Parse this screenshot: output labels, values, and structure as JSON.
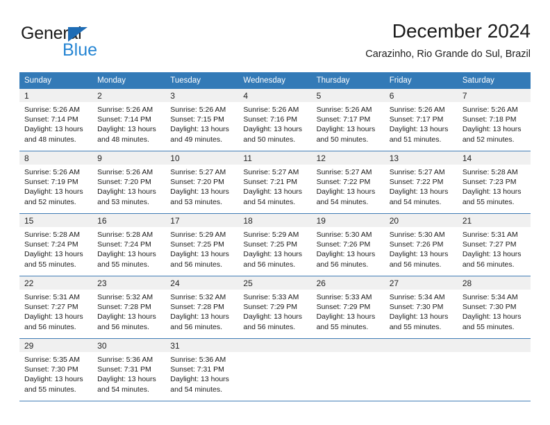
{
  "logo": {
    "primary_text": "General",
    "secondary_text": "Blue",
    "triangle_icon": "triangle-icon",
    "primary_color": "#1a1a1a",
    "secondary_color": "#2585d3",
    "triangle_color": "#1e6cb5"
  },
  "header": {
    "title": "December 2024",
    "subtitle": "Carazinho, Rio Grande do Sul, Brazil"
  },
  "theme": {
    "header_row_bg": "#337ab7",
    "header_row_text": "#ffffff",
    "day_number_bg": "#f0f0f0",
    "grid_line": "#3f7cb5",
    "body_text": "#1a1a1a"
  },
  "weekdays": [
    "Sunday",
    "Monday",
    "Tuesday",
    "Wednesday",
    "Thursday",
    "Friday",
    "Saturday"
  ],
  "calendar": {
    "month": "December",
    "year": 2024,
    "weeks": [
      [
        {
          "day": "1",
          "sunrise": "Sunrise: 5:26 AM",
          "sunset": "Sunset: 7:14 PM",
          "daylight_1": "Daylight: 13 hours",
          "daylight_2": "and 48 minutes."
        },
        {
          "day": "2",
          "sunrise": "Sunrise: 5:26 AM",
          "sunset": "Sunset: 7:14 PM",
          "daylight_1": "Daylight: 13 hours",
          "daylight_2": "and 48 minutes."
        },
        {
          "day": "3",
          "sunrise": "Sunrise: 5:26 AM",
          "sunset": "Sunset: 7:15 PM",
          "daylight_1": "Daylight: 13 hours",
          "daylight_2": "and 49 minutes."
        },
        {
          "day": "4",
          "sunrise": "Sunrise: 5:26 AM",
          "sunset": "Sunset: 7:16 PM",
          "daylight_1": "Daylight: 13 hours",
          "daylight_2": "and 50 minutes."
        },
        {
          "day": "5",
          "sunrise": "Sunrise: 5:26 AM",
          "sunset": "Sunset: 7:17 PM",
          "daylight_1": "Daylight: 13 hours",
          "daylight_2": "and 50 minutes."
        },
        {
          "day": "6",
          "sunrise": "Sunrise: 5:26 AM",
          "sunset": "Sunset: 7:17 PM",
          "daylight_1": "Daylight: 13 hours",
          "daylight_2": "and 51 minutes."
        },
        {
          "day": "7",
          "sunrise": "Sunrise: 5:26 AM",
          "sunset": "Sunset: 7:18 PM",
          "daylight_1": "Daylight: 13 hours",
          "daylight_2": "and 52 minutes."
        }
      ],
      [
        {
          "day": "8",
          "sunrise": "Sunrise: 5:26 AM",
          "sunset": "Sunset: 7:19 PM",
          "daylight_1": "Daylight: 13 hours",
          "daylight_2": "and 52 minutes."
        },
        {
          "day": "9",
          "sunrise": "Sunrise: 5:26 AM",
          "sunset": "Sunset: 7:20 PM",
          "daylight_1": "Daylight: 13 hours",
          "daylight_2": "and 53 minutes."
        },
        {
          "day": "10",
          "sunrise": "Sunrise: 5:27 AM",
          "sunset": "Sunset: 7:20 PM",
          "daylight_1": "Daylight: 13 hours",
          "daylight_2": "and 53 minutes."
        },
        {
          "day": "11",
          "sunrise": "Sunrise: 5:27 AM",
          "sunset": "Sunset: 7:21 PM",
          "daylight_1": "Daylight: 13 hours",
          "daylight_2": "and 54 minutes."
        },
        {
          "day": "12",
          "sunrise": "Sunrise: 5:27 AM",
          "sunset": "Sunset: 7:22 PM",
          "daylight_1": "Daylight: 13 hours",
          "daylight_2": "and 54 minutes."
        },
        {
          "day": "13",
          "sunrise": "Sunrise: 5:27 AM",
          "sunset": "Sunset: 7:22 PM",
          "daylight_1": "Daylight: 13 hours",
          "daylight_2": "and 54 minutes."
        },
        {
          "day": "14",
          "sunrise": "Sunrise: 5:28 AM",
          "sunset": "Sunset: 7:23 PM",
          "daylight_1": "Daylight: 13 hours",
          "daylight_2": "and 55 minutes."
        }
      ],
      [
        {
          "day": "15",
          "sunrise": "Sunrise: 5:28 AM",
          "sunset": "Sunset: 7:24 PM",
          "daylight_1": "Daylight: 13 hours",
          "daylight_2": "and 55 minutes."
        },
        {
          "day": "16",
          "sunrise": "Sunrise: 5:28 AM",
          "sunset": "Sunset: 7:24 PM",
          "daylight_1": "Daylight: 13 hours",
          "daylight_2": "and 55 minutes."
        },
        {
          "day": "17",
          "sunrise": "Sunrise: 5:29 AM",
          "sunset": "Sunset: 7:25 PM",
          "daylight_1": "Daylight: 13 hours",
          "daylight_2": "and 56 minutes."
        },
        {
          "day": "18",
          "sunrise": "Sunrise: 5:29 AM",
          "sunset": "Sunset: 7:25 PM",
          "daylight_1": "Daylight: 13 hours",
          "daylight_2": "and 56 minutes."
        },
        {
          "day": "19",
          "sunrise": "Sunrise: 5:30 AM",
          "sunset": "Sunset: 7:26 PM",
          "daylight_1": "Daylight: 13 hours",
          "daylight_2": "and 56 minutes."
        },
        {
          "day": "20",
          "sunrise": "Sunrise: 5:30 AM",
          "sunset": "Sunset: 7:26 PM",
          "daylight_1": "Daylight: 13 hours",
          "daylight_2": "and 56 minutes."
        },
        {
          "day": "21",
          "sunrise": "Sunrise: 5:31 AM",
          "sunset": "Sunset: 7:27 PM",
          "daylight_1": "Daylight: 13 hours",
          "daylight_2": "and 56 minutes."
        }
      ],
      [
        {
          "day": "22",
          "sunrise": "Sunrise: 5:31 AM",
          "sunset": "Sunset: 7:27 PM",
          "daylight_1": "Daylight: 13 hours",
          "daylight_2": "and 56 minutes."
        },
        {
          "day": "23",
          "sunrise": "Sunrise: 5:32 AM",
          "sunset": "Sunset: 7:28 PM",
          "daylight_1": "Daylight: 13 hours",
          "daylight_2": "and 56 minutes."
        },
        {
          "day": "24",
          "sunrise": "Sunrise: 5:32 AM",
          "sunset": "Sunset: 7:28 PM",
          "daylight_1": "Daylight: 13 hours",
          "daylight_2": "and 56 minutes."
        },
        {
          "day": "25",
          "sunrise": "Sunrise: 5:33 AM",
          "sunset": "Sunset: 7:29 PM",
          "daylight_1": "Daylight: 13 hours",
          "daylight_2": "and 56 minutes."
        },
        {
          "day": "26",
          "sunrise": "Sunrise: 5:33 AM",
          "sunset": "Sunset: 7:29 PM",
          "daylight_1": "Daylight: 13 hours",
          "daylight_2": "and 55 minutes."
        },
        {
          "day": "27",
          "sunrise": "Sunrise: 5:34 AM",
          "sunset": "Sunset: 7:30 PM",
          "daylight_1": "Daylight: 13 hours",
          "daylight_2": "and 55 minutes."
        },
        {
          "day": "28",
          "sunrise": "Sunrise: 5:34 AM",
          "sunset": "Sunset: 7:30 PM",
          "daylight_1": "Daylight: 13 hours",
          "daylight_2": "and 55 minutes."
        }
      ],
      [
        {
          "day": "29",
          "sunrise": "Sunrise: 5:35 AM",
          "sunset": "Sunset: 7:30 PM",
          "daylight_1": "Daylight: 13 hours",
          "daylight_2": "and 55 minutes."
        },
        {
          "day": "30",
          "sunrise": "Sunrise: 5:36 AM",
          "sunset": "Sunset: 7:31 PM",
          "daylight_1": "Daylight: 13 hours",
          "daylight_2": "and 54 minutes."
        },
        {
          "day": "31",
          "sunrise": "Sunrise: 5:36 AM",
          "sunset": "Sunset: 7:31 PM",
          "daylight_1": "Daylight: 13 hours",
          "daylight_2": "and 54 minutes."
        },
        {
          "day": "",
          "sunrise": "",
          "sunset": "",
          "daylight_1": "",
          "daylight_2": ""
        },
        {
          "day": "",
          "sunrise": "",
          "sunset": "",
          "daylight_1": "",
          "daylight_2": ""
        },
        {
          "day": "",
          "sunrise": "",
          "sunset": "",
          "daylight_1": "",
          "daylight_2": ""
        },
        {
          "day": "",
          "sunrise": "",
          "sunset": "",
          "daylight_1": "",
          "daylight_2": ""
        }
      ]
    ]
  }
}
